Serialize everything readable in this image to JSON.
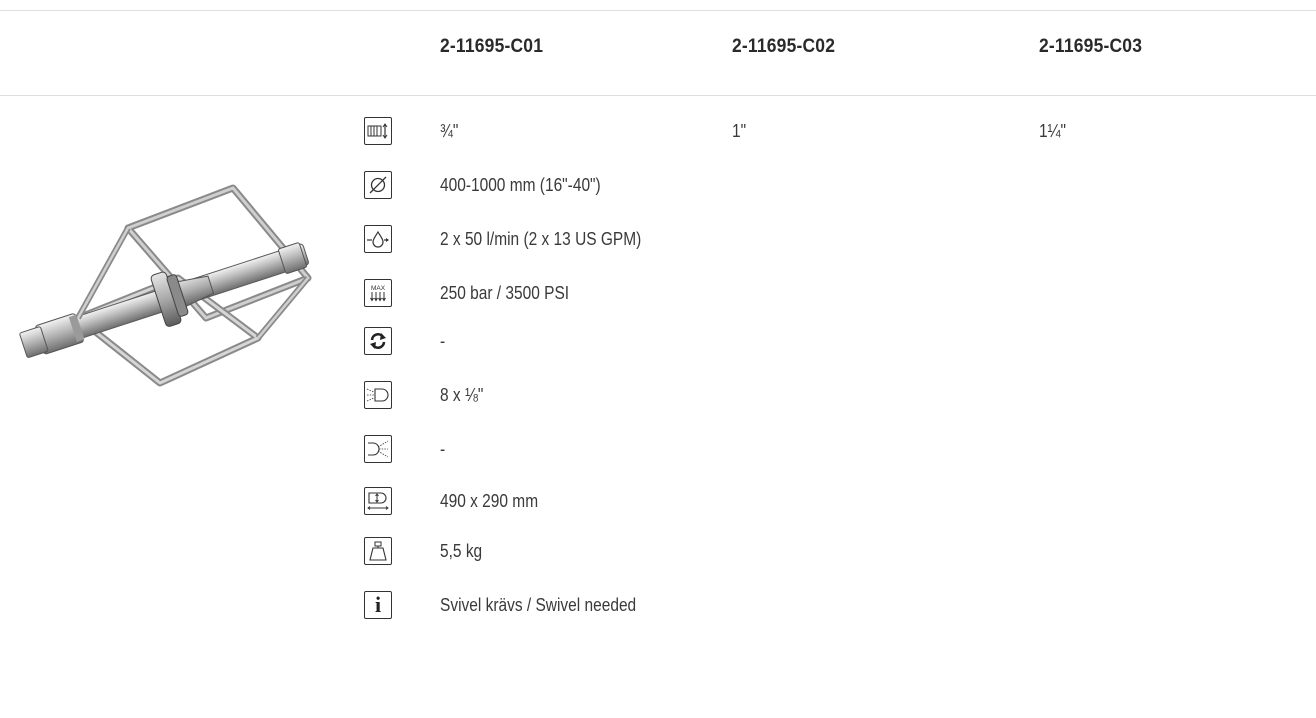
{
  "columns": [
    "2-11695-C01",
    "2-11695-C02",
    "2-11695-C03"
  ],
  "rows": [
    {
      "icon": "hose-connection-icon",
      "values": [
        "¾\"",
        "1\"",
        "1¼\""
      ]
    },
    {
      "icon": "diameter-icon",
      "values": [
        "400-1000 mm (16\"-40\")",
        "",
        ""
      ]
    },
    {
      "icon": "flow-icon",
      "values": [
        "2 x 50 l/min (2 x 13 US GPM)",
        "",
        ""
      ]
    },
    {
      "icon": "max-pressure-icon",
      "values": [
        "250 bar / 3500 PSI",
        "",
        ""
      ]
    },
    {
      "icon": "rotation-icon",
      "values": [
        "-",
        "",
        ""
      ]
    },
    {
      "icon": "forward-nozzles-icon",
      "values": [
        "8 x ⅛\"",
        "",
        ""
      ]
    },
    {
      "icon": "backward-nozzles-icon",
      "values": [
        "-",
        "",
        ""
      ]
    },
    {
      "icon": "dimensions-icon",
      "values": [
        "490 x 290 mm",
        "",
        ""
      ]
    },
    {
      "icon": "weight-icon",
      "values": [
        "5,5 kg",
        "",
        ""
      ]
    },
    {
      "icon": "info-icon",
      "values": [
        "Svivel krävs / Swivel needed",
        "",
        ""
      ]
    }
  ],
  "icon_text": {
    "max": "MAX",
    "info": "i"
  }
}
